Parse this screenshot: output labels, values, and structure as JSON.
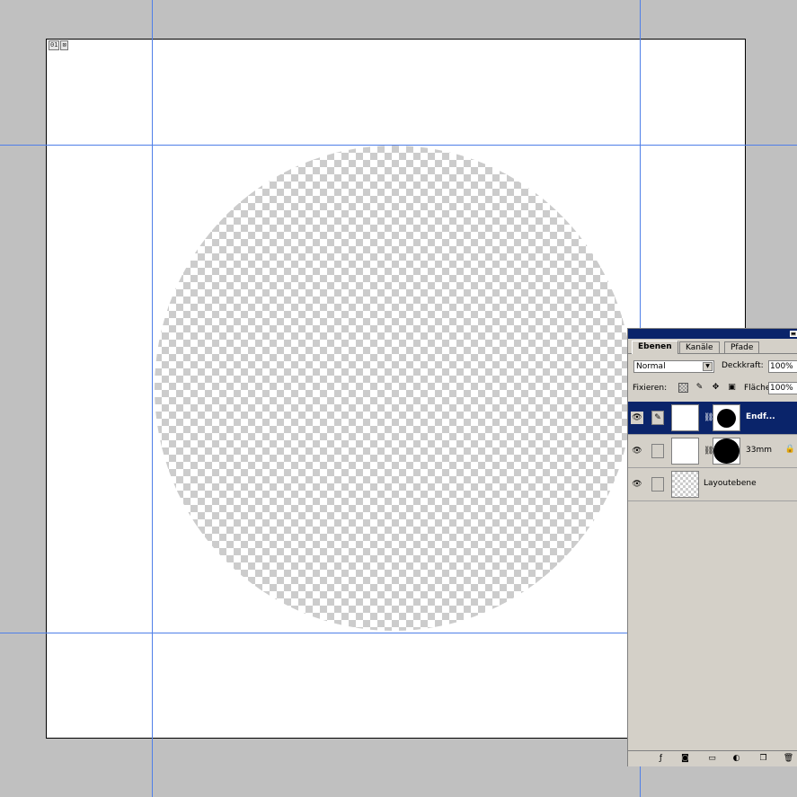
{
  "document": {
    "badge_left": "01",
    "badge_right": "⊠"
  },
  "layers_panel": {
    "tabs": [
      {
        "label": "Ebenen",
        "active": true
      },
      {
        "label": "Kanäle",
        "active": false
      },
      {
        "label": "Pfade",
        "active": false
      }
    ],
    "blend_mode": "Normal",
    "opacity_label": "Deckkraft:",
    "opacity_value": "100%",
    "lock_label": "Fixieren:",
    "fill_label": "Fläche",
    "fill_value": "100%",
    "layers": [
      {
        "name": "Endf...",
        "selected": true,
        "has_mask": true
      },
      {
        "name": "33mm",
        "selected": false,
        "has_mask": true,
        "locked": true
      },
      {
        "name": "Layoutebene",
        "selected": false,
        "has_mask": false
      }
    ]
  },
  "colors": {
    "canvas_bg": "#c0c0c0",
    "guide": "#4f7fe8",
    "panel_bg": "#d4d0c8",
    "selection": "#0a246a"
  }
}
